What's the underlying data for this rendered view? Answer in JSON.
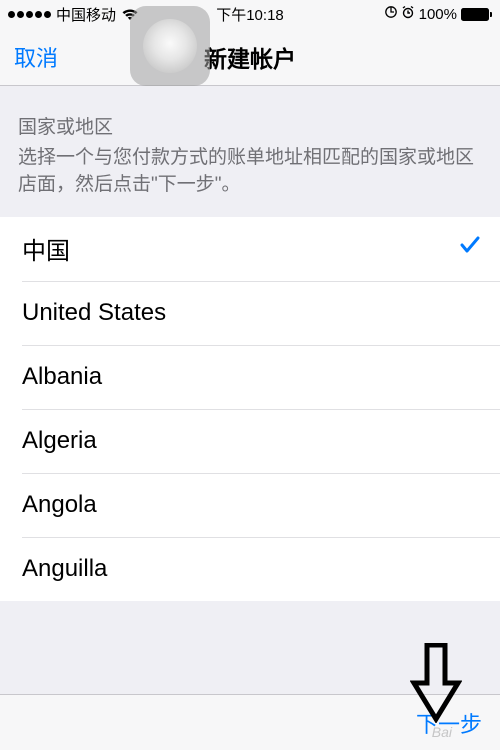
{
  "status": {
    "carrier": "中国移动",
    "time": "下午10:18",
    "battery_percent": "100%"
  },
  "nav": {
    "cancel": "取消",
    "title": "新建帐户"
  },
  "section": {
    "label": "国家或地区",
    "description": "选择一个与您付款方式的账单地址相匹配的国家或地区店面，然后点击\"下一步\"。"
  },
  "countries": [
    {
      "name": "中国",
      "selected": true
    },
    {
      "name": "United States",
      "selected": false
    },
    {
      "name": "Albania",
      "selected": false
    },
    {
      "name": "Algeria",
      "selected": false
    },
    {
      "name": "Angola",
      "selected": false
    },
    {
      "name": "Anguilla",
      "selected": false
    }
  ],
  "toolbar": {
    "next": "下一步"
  },
  "watermark": "Bai"
}
